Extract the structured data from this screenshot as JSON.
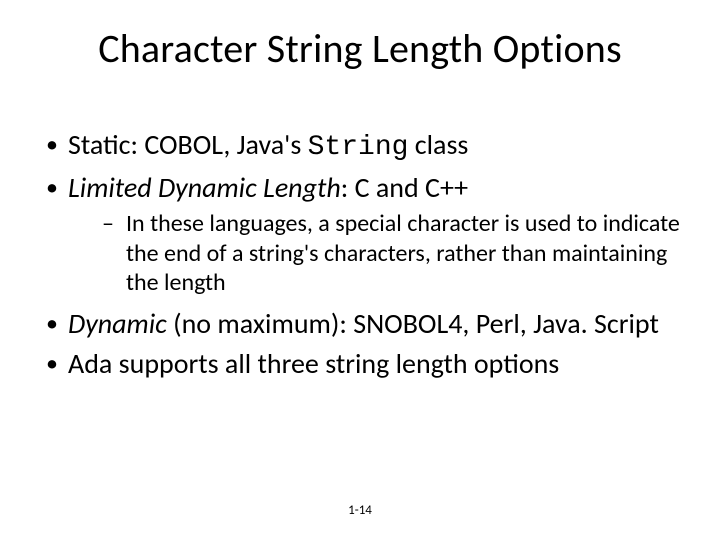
{
  "title": "Character String Length Options",
  "bullets": {
    "b1_prefix": "Static: COBOL, Java's ",
    "b1_code": "String",
    "b1_suffix": " class",
    "b2_em": "Limited Dynamic Length",
    "b2_rest": ": C and C++",
    "b2_sub": "In these languages, a special character is used to indicate the end of a string's characters, rather than maintaining the length",
    "b3_em": "Dynamic",
    "b3_rest": " (no maximum): SNOBOL4, Perl, Java. Script",
    "b4": "Ada supports all three string length options"
  },
  "footer": "1-14"
}
